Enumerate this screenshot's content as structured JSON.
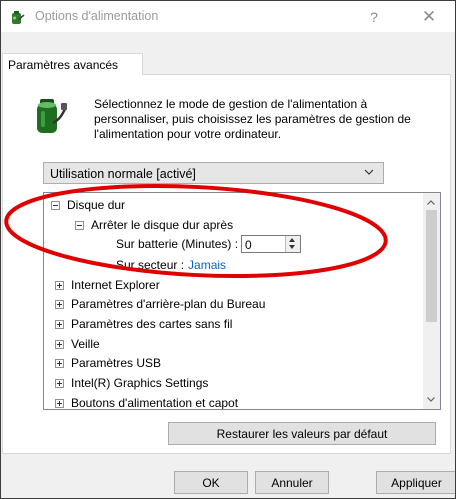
{
  "window": {
    "title": "Options d'alimentation",
    "help_glyph": "?",
    "close_glyph": "✕"
  },
  "tab": {
    "label": "Paramètres avancés"
  },
  "description": "Sélectionnez le mode de gestion de l'alimentation à personnaliser, puis choisissez les paramètres de gestion de l'alimentation pour votre ordinateur.",
  "plan_select": {
    "value": "Utilisation normale [activé]"
  },
  "tree": {
    "disk_group": "Disque dur",
    "disk_subgroup": "Arrêter le disque dur après",
    "battery_label": "Sur batterie (Minutes) :",
    "battery_value": "0",
    "ac_label": "Sur secteur :",
    "ac_value": "Jamais",
    "items": [
      "Internet Explorer",
      "Paramètres d'arrière-plan du Bureau",
      "Paramètres des cartes sans fil",
      "Veille",
      "Paramètres USB",
      "Intel(R) Graphics Settings",
      "Boutons d'alimentation et capot"
    ]
  },
  "buttons": {
    "restore": "Restaurer les valeurs par défaut",
    "ok": "OK",
    "cancel": "Annuler",
    "apply": "Appliquer"
  },
  "colors": {
    "link": "#0066cc",
    "annotation": "#e00000"
  },
  "icons": {
    "app": "battery-plug-icon",
    "description": "battery-plug-icon"
  }
}
